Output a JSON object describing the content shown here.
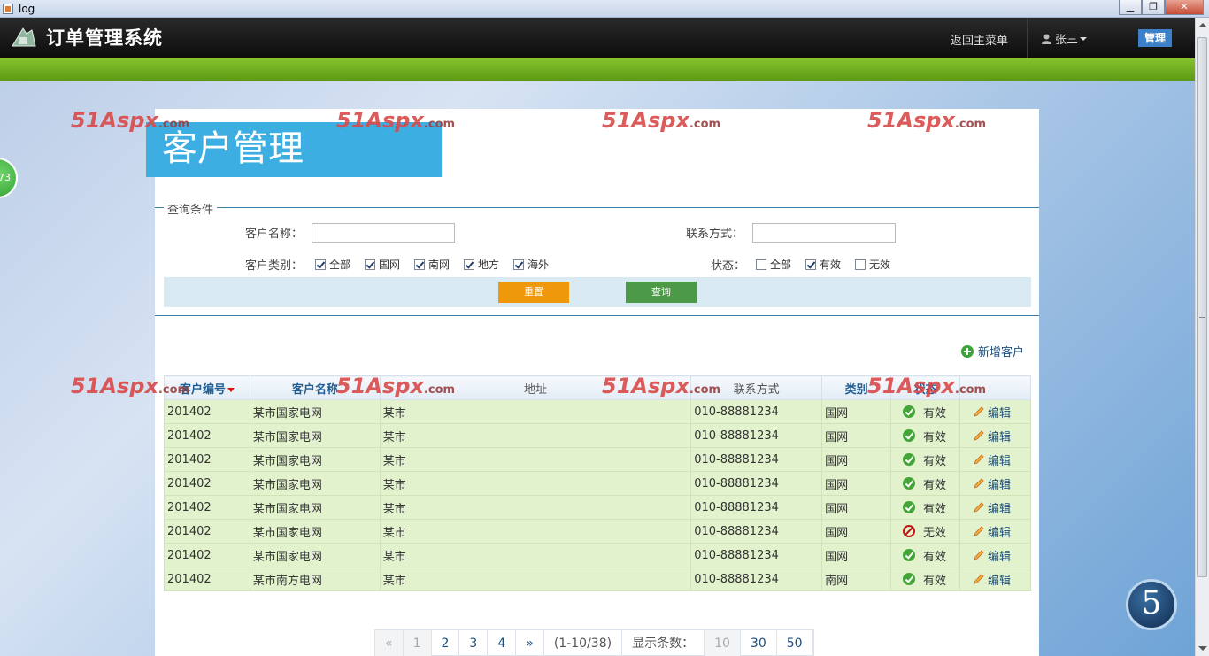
{
  "window": {
    "title": "log",
    "minimize": "▁",
    "maximize": "❐",
    "close": "✕"
  },
  "header": {
    "app_title": "订单管理系统",
    "back_link": "返回主菜单",
    "user_name": "张三",
    "manage_button": "管理"
  },
  "floating_badge": "73",
  "page_title": "客户管理",
  "query": {
    "legend": "查询条件",
    "customer_name_label": "客户名称：",
    "customer_name_value": "",
    "contact_label": "联系方式：",
    "contact_value": "",
    "category_label": "客户类别：",
    "categories": [
      {
        "label": "全部",
        "checked": true
      },
      {
        "label": "国网",
        "checked": true
      },
      {
        "label": "南网",
        "checked": true
      },
      {
        "label": "地方",
        "checked": true
      },
      {
        "label": "海外",
        "checked": true
      }
    ],
    "status_label": "状态：",
    "statuses": [
      {
        "label": "全部",
        "checked": false
      },
      {
        "label": "有效",
        "checked": true
      },
      {
        "label": "无效",
        "checked": false
      }
    ],
    "reset_button": "重置",
    "search_button": "查询"
  },
  "add_customer_link": "新增客户",
  "table": {
    "columns": [
      "客户编号",
      "客户名称",
      "地址",
      "联系方式",
      "类别",
      "状态",
      ""
    ],
    "edit_label": "编辑",
    "rows": [
      {
        "id": "201402",
        "name": "某市国家电网",
        "address": "某市",
        "contact": "010-88881234",
        "category": "国网",
        "status": "有效",
        "valid": true
      },
      {
        "id": "201402",
        "name": "某市国家电网",
        "address": "某市",
        "contact": "010-88881234",
        "category": "国网",
        "status": "有效",
        "valid": true
      },
      {
        "id": "201402",
        "name": "某市国家电网",
        "address": "某市",
        "contact": "010-88881234",
        "category": "国网",
        "status": "有效",
        "valid": true
      },
      {
        "id": "201402",
        "name": "某市国家电网",
        "address": "某市",
        "contact": "010-88881234",
        "category": "国网",
        "status": "有效",
        "valid": true
      },
      {
        "id": "201402",
        "name": "某市国家电网",
        "address": "某市",
        "contact": "010-88881234",
        "category": "国网",
        "status": "有效",
        "valid": true
      },
      {
        "id": "201402",
        "name": "某市国家电网",
        "address": "某市",
        "contact": "010-88881234",
        "category": "国网",
        "status": "无效",
        "valid": false
      },
      {
        "id": "201402",
        "name": "某市国家电网",
        "address": "某市",
        "contact": "010-88881234",
        "category": "国网",
        "status": "有效",
        "valid": true
      },
      {
        "id": "201402",
        "name": "某市南方电网",
        "address": "某市",
        "contact": "010-88881234",
        "category": "南网",
        "status": "有效",
        "valid": true
      }
    ]
  },
  "pager": {
    "first": "«",
    "pages": [
      "1",
      "2",
      "3",
      "4"
    ],
    "current_page": "1",
    "last": "»",
    "range": "(1-10/38)",
    "page_size_label": "显示条数：",
    "page_sizes": [
      "10",
      "30",
      "50"
    ],
    "current_size": "10"
  },
  "watermark": {
    "brand": "51Aspx",
    "suffix": ".com"
  },
  "corner_logo": "5",
  "colors": {
    "accent_green": "#6aaa1c",
    "title_blue": "#3daee2",
    "reset_orange": "#f0980c",
    "search_green": "#4c9a47",
    "row_green": "#e2f2cd"
  }
}
